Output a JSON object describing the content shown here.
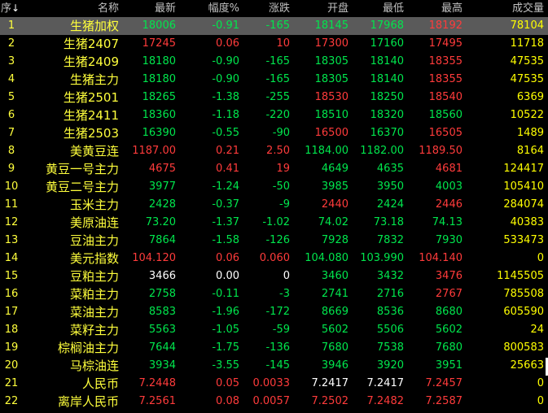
{
  "header": {
    "idx": "序",
    "sort_arrow": "↓",
    "name": "名称",
    "last": "最新",
    "pct": "幅度%",
    "chg": "涨跌",
    "open": "开盘",
    "low": "最低",
    "high": "最高",
    "vol": "成交量"
  },
  "colors": {
    "up": "#ff3b3b",
    "down": "#00e64d",
    "flat": "#ffffff",
    "volume": "#ffff00",
    "selected_bg": "#5a5a5a"
  },
  "rows": [
    {
      "idx": "1",
      "name": "生猪加权",
      "last": "18006",
      "pct": "-0.91",
      "chg": "-165",
      "open": "18145",
      "low": "17968",
      "high": "18192",
      "vol": "78104",
      "c": {
        "last": "down",
        "pct": "down",
        "chg": "down",
        "open": "down",
        "low": "down",
        "high": "up"
      }
    },
    {
      "idx": "2",
      "name": "生猪2407",
      "last": "17245",
      "pct": "0.06",
      "chg": "10",
      "open": "17300",
      "low": "17160",
      "high": "17495",
      "vol": "11718",
      "c": {
        "last": "up",
        "pct": "up",
        "chg": "up",
        "open": "up",
        "low": "down",
        "high": "up"
      }
    },
    {
      "idx": "3",
      "name": "生猪2409",
      "last": "18180",
      "pct": "-0.90",
      "chg": "-165",
      "open": "18305",
      "low": "18140",
      "high": "18355",
      "vol": "47535",
      "c": {
        "last": "down",
        "pct": "down",
        "chg": "down",
        "open": "down",
        "low": "down",
        "high": "up"
      }
    },
    {
      "idx": "4",
      "name": "生猪主力",
      "last": "18180",
      "pct": "-0.90",
      "chg": "-165",
      "open": "18305",
      "low": "18140",
      "high": "18355",
      "vol": "47535",
      "c": {
        "last": "down",
        "pct": "down",
        "chg": "down",
        "open": "down",
        "low": "down",
        "high": "up"
      }
    },
    {
      "idx": "5",
      "name": "生猪2501",
      "last": "18265",
      "pct": "-1.38",
      "chg": "-255",
      "open": "18530",
      "low": "18250",
      "high": "18540",
      "vol": "6369",
      "c": {
        "last": "down",
        "pct": "down",
        "chg": "down",
        "open": "up",
        "low": "down",
        "high": "up"
      }
    },
    {
      "idx": "6",
      "name": "生猪2411",
      "last": "18360",
      "pct": "-1.18",
      "chg": "-220",
      "open": "18510",
      "low": "18320",
      "high": "18560",
      "vol": "10522",
      "c": {
        "last": "down",
        "pct": "down",
        "chg": "down",
        "open": "down",
        "low": "down",
        "high": "down"
      }
    },
    {
      "idx": "7",
      "name": "生猪2503",
      "last": "16390",
      "pct": "-0.55",
      "chg": "-90",
      "open": "16500",
      "low": "16370",
      "high": "16505",
      "vol": "1489",
      "c": {
        "last": "down",
        "pct": "down",
        "chg": "down",
        "open": "up",
        "low": "down",
        "high": "up"
      }
    },
    {
      "idx": "8",
      "name": "美黄豆连",
      "last": "1187.00",
      "pct": "0.21",
      "chg": "2.50",
      "open": "1184.00",
      "low": "1182.00",
      "high": "1189.50",
      "vol": "8164",
      "c": {
        "last": "up",
        "pct": "up",
        "chg": "up",
        "open": "down",
        "low": "down",
        "high": "up"
      }
    },
    {
      "idx": "9",
      "name": "黄豆一号主力",
      "last": "4675",
      "pct": "0.41",
      "chg": "19",
      "open": "4649",
      "low": "4635",
      "high": "4681",
      "vol": "124417",
      "c": {
        "last": "up",
        "pct": "up",
        "chg": "up",
        "open": "down",
        "low": "down",
        "high": "up"
      }
    },
    {
      "idx": "10",
      "name": "黄豆二号主力",
      "last": "3977",
      "pct": "-1.24",
      "chg": "-50",
      "open": "3985",
      "low": "3950",
      "high": "4003",
      "vol": "105410",
      "c": {
        "last": "down",
        "pct": "down",
        "chg": "down",
        "open": "down",
        "low": "down",
        "high": "down"
      }
    },
    {
      "idx": "11",
      "name": "玉米主力",
      "last": "2428",
      "pct": "-0.37",
      "chg": "-9",
      "open": "2440",
      "low": "2424",
      "high": "2446",
      "vol": "284074",
      "c": {
        "last": "down",
        "pct": "down",
        "chg": "down",
        "open": "up",
        "low": "down",
        "high": "up"
      }
    },
    {
      "idx": "12",
      "name": "美原油连",
      "last": "73.20",
      "pct": "-1.37",
      "chg": "-1.02",
      "open": "74.02",
      "low": "73.18",
      "high": "74.13",
      "vol": "40383",
      "c": {
        "last": "down",
        "pct": "down",
        "chg": "down",
        "open": "down",
        "low": "down",
        "high": "down"
      }
    },
    {
      "idx": "13",
      "name": "豆油主力",
      "last": "7864",
      "pct": "-1.58",
      "chg": "-126",
      "open": "7928",
      "low": "7832",
      "high": "7930",
      "vol": "533473",
      "c": {
        "last": "down",
        "pct": "down",
        "chg": "down",
        "open": "down",
        "low": "down",
        "high": "down"
      }
    },
    {
      "idx": "14",
      "name": "美元指数",
      "last": "104.120",
      "pct": "0.06",
      "chg": "0.060",
      "open": "104.080",
      "low": "103.990",
      "high": "104.140",
      "vol": "0",
      "c": {
        "last": "up",
        "pct": "up",
        "chg": "up",
        "open": "down",
        "low": "down",
        "high": "up"
      }
    },
    {
      "idx": "15",
      "name": "豆粕主力",
      "last": "3466",
      "pct": "0.00",
      "chg": "0",
      "open": "3460",
      "low": "3432",
      "high": "3476",
      "vol": "1145505",
      "c": {
        "last": "flat",
        "pct": "flat",
        "chg": "flat",
        "open": "down",
        "low": "down",
        "high": "up"
      }
    },
    {
      "idx": "16",
      "name": "菜粕主力",
      "last": "2758",
      "pct": "-0.11",
      "chg": "-3",
      "open": "2741",
      "low": "2716",
      "high": "2767",
      "vol": "785508",
      "c": {
        "last": "down",
        "pct": "down",
        "chg": "down",
        "open": "down",
        "low": "down",
        "high": "up"
      }
    },
    {
      "idx": "17",
      "name": "菜油主力",
      "last": "8583",
      "pct": "-1.96",
      "chg": "-172",
      "open": "8669",
      "low": "8536",
      "high": "8680",
      "vol": "605590",
      "c": {
        "last": "down",
        "pct": "down",
        "chg": "down",
        "open": "down",
        "low": "down",
        "high": "down"
      }
    },
    {
      "idx": "18",
      "name": "菜籽主力",
      "last": "5563",
      "pct": "-1.05",
      "chg": "-59",
      "open": "5602",
      "low": "5506",
      "high": "5602",
      "vol": "24",
      "c": {
        "last": "down",
        "pct": "down",
        "chg": "down",
        "open": "down",
        "low": "down",
        "high": "down"
      }
    },
    {
      "idx": "19",
      "name": "棕榈油主力",
      "last": "7644",
      "pct": "-1.75",
      "chg": "-136",
      "open": "7680",
      "low": "7538",
      "high": "7680",
      "vol": "800583",
      "c": {
        "last": "down",
        "pct": "down",
        "chg": "down",
        "open": "down",
        "low": "down",
        "high": "down"
      }
    },
    {
      "idx": "20",
      "name": "马棕油连",
      "last": "3934",
      "pct": "-3.55",
      "chg": "-145",
      "open": "3946",
      "low": "3920",
      "high": "3951",
      "vol": "25663",
      "c": {
        "last": "down",
        "pct": "down",
        "chg": "down",
        "open": "down",
        "low": "down",
        "high": "down"
      }
    },
    {
      "idx": "21",
      "name": "人民币",
      "last": "7.2448",
      "pct": "0.05",
      "chg": "0.0033",
      "open": "7.2417",
      "low": "7.2417",
      "high": "7.2457",
      "vol": "0",
      "c": {
        "last": "up",
        "pct": "up",
        "chg": "up",
        "open": "flat",
        "low": "flat",
        "high": "up"
      }
    },
    {
      "idx": "22",
      "name": "离岸人民币",
      "last": "7.2561",
      "pct": "0.08",
      "chg": "0.0057",
      "open": "7.2502",
      "low": "7.2482",
      "high": "7.2587",
      "vol": "0",
      "c": {
        "last": "up",
        "pct": "up",
        "chg": "up",
        "open": "up",
        "low": "up",
        "high": "up"
      }
    }
  ]
}
